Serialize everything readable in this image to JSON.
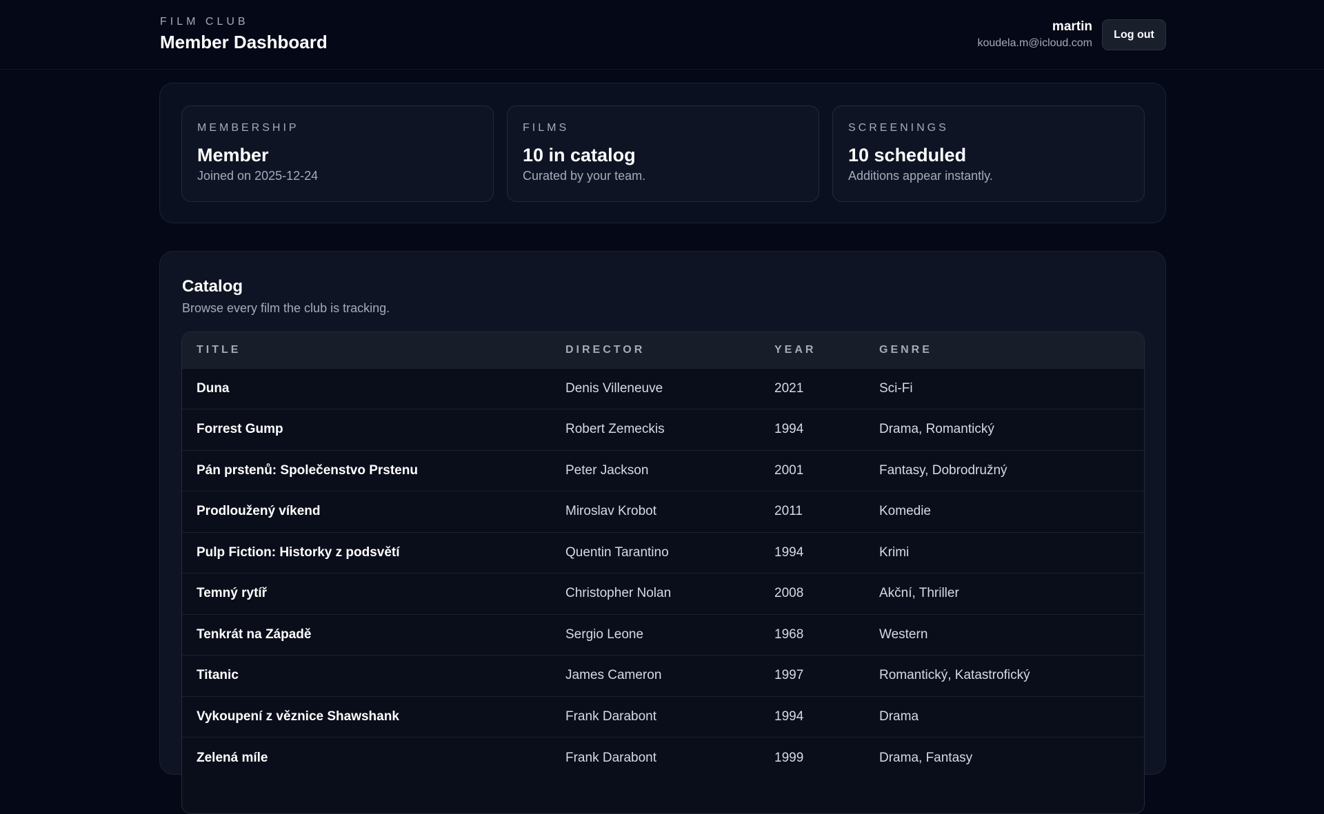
{
  "header": {
    "kicker": "FILM CLUB",
    "title": "Member Dashboard",
    "user_name": "martin",
    "user_email": "koudela.m@icloud.com",
    "logout_label": "Log out"
  },
  "stats": [
    {
      "label": "MEMBERSHIP",
      "value": "Member",
      "sub": "Joined on 2025-12-24"
    },
    {
      "label": "FILMS",
      "value": "10 in catalog",
      "sub": "Curated by your team."
    },
    {
      "label": "SCREENINGS",
      "value": "10 scheduled",
      "sub": "Additions appear instantly."
    }
  ],
  "catalog": {
    "title": "Catalog",
    "subtitle": "Browse every film the club is tracking.",
    "columns": [
      "TITLE",
      "DIRECTOR",
      "YEAR",
      "GENRE"
    ],
    "rows": [
      {
        "title": "Duna",
        "director": "Denis Villeneuve",
        "year": "2021",
        "genre": "Sci-Fi"
      },
      {
        "title": "Forrest Gump",
        "director": "Robert Zemeckis",
        "year": "1994",
        "genre": "Drama, Romantický"
      },
      {
        "title": "Pán prstenů: Společenstvo Prstenu",
        "director": "Peter Jackson",
        "year": "2001",
        "genre": "Fantasy, Dobrodružný"
      },
      {
        "title": "Prodloužený víkend",
        "director": "Miroslav Krobot",
        "year": "2011",
        "genre": "Komedie"
      },
      {
        "title": "Pulp Fiction: Historky z podsvětí",
        "director": "Quentin Tarantino",
        "year": "1994",
        "genre": "Krimi"
      },
      {
        "title": "Temný rytíř",
        "director": "Christopher Nolan",
        "year": "2008",
        "genre": "Akční, Thriller"
      },
      {
        "title": "Tenkrát na Západě",
        "director": "Sergio Leone",
        "year": "1968",
        "genre": "Western"
      },
      {
        "title": "Titanic",
        "director": "James Cameron",
        "year": "1997",
        "genre": "Romantický, Katastrofický"
      },
      {
        "title": "Vykoupení z věznice Shawshank",
        "director": "Frank Darabont",
        "year": "1994",
        "genre": "Drama"
      },
      {
        "title": "Zelená míle",
        "director": "Frank Darabont",
        "year": "1999",
        "genre": "Drama, Fantasy"
      }
    ]
  }
}
